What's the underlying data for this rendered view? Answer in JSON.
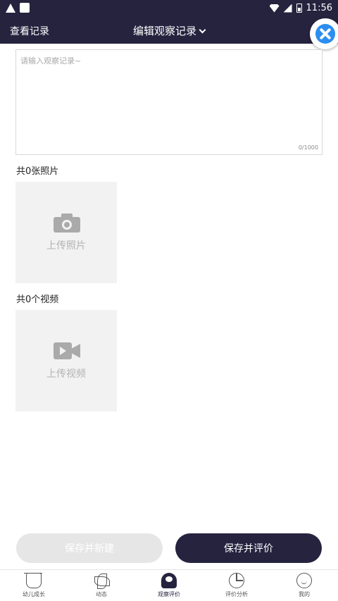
{
  "status_bar": {
    "time": "11:56"
  },
  "header": {
    "left_link": "查看记录",
    "title": "编辑观察记录"
  },
  "note": {
    "placeholder": "请输入观察记录~",
    "value": "",
    "counter": "0/1000"
  },
  "photos": {
    "count_label": "共0张照片",
    "upload_label": "上传照片"
  },
  "videos": {
    "count_label": "共0个视频",
    "upload_label": "上传视频"
  },
  "actions": {
    "save_new": "保存并新建",
    "save_evaluate": "保存并评价"
  },
  "tabs": [
    {
      "label": "幼儿成长",
      "icon": "home-icon",
      "active": false
    },
    {
      "label": "动态",
      "icon": "pinwheel-icon",
      "active": false
    },
    {
      "label": "观察评价",
      "icon": "badge-icon",
      "active": true
    },
    {
      "label": "评价分析",
      "icon": "pie-chart-icon",
      "active": false
    },
    {
      "label": "我的",
      "icon": "face-icon",
      "active": false
    }
  ],
  "colors": {
    "primary": "#26233f",
    "disabled": "#e6e6e6",
    "accent": "#2b8ef0"
  }
}
